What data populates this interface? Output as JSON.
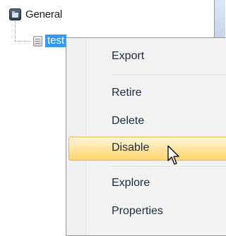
{
  "tree": {
    "root": {
      "label": "General",
      "icon": "folder-app-icon"
    },
    "child": {
      "label": "test",
      "icon": "document-icon",
      "selected": true
    }
  },
  "context_menu": {
    "items": [
      {
        "label": "Export"
      },
      {
        "label": "Retire"
      },
      {
        "label": "Delete"
      },
      {
        "label": "Disable",
        "highlighted": true
      },
      {
        "label": "Explore"
      },
      {
        "label": "Properties"
      }
    ]
  },
  "colors": {
    "selection": "#3399ff",
    "hover_gradient_top": "#fff6dc",
    "hover_gradient_bottom": "#ffd66b",
    "menu_background": "#f2f2f2",
    "menu_text": "#1c2a44"
  },
  "cursor": {
    "icon": "arrow-cursor-icon"
  }
}
